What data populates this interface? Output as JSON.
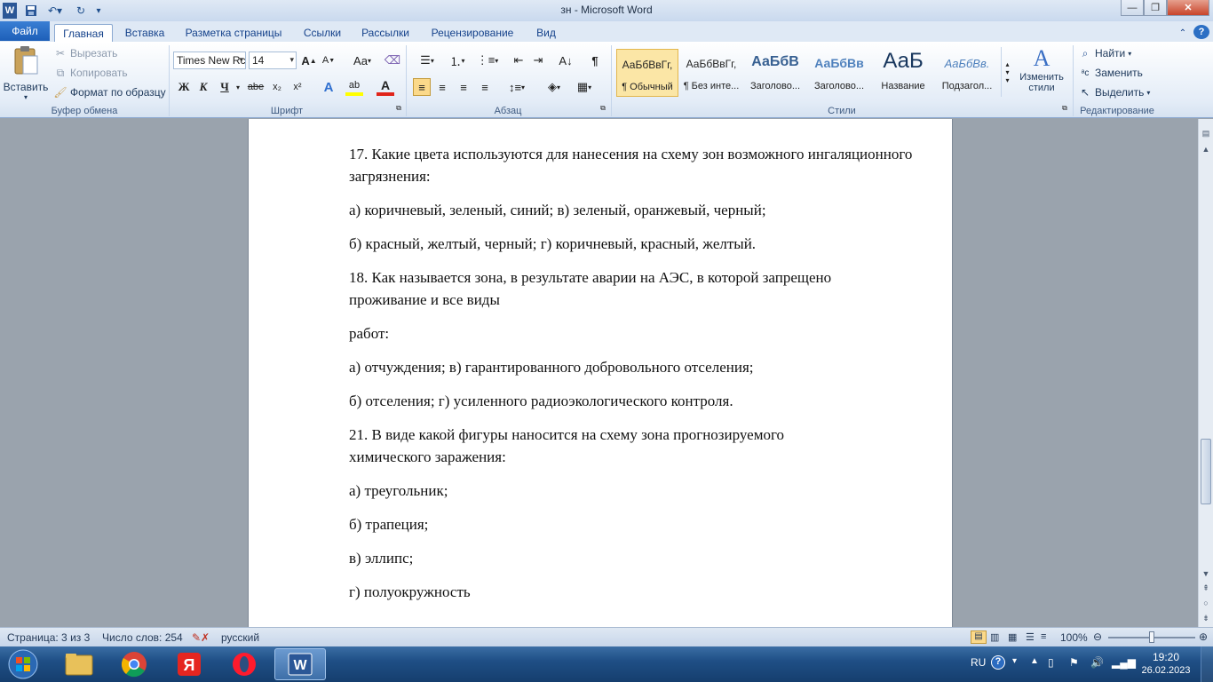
{
  "window": {
    "title": "зн  -  Microsoft Word",
    "quick_access": [
      "word-logo-icon",
      "save-icon",
      "undo-icon",
      "redo-icon",
      "customize-icon"
    ]
  },
  "tabs": [
    "Файл",
    "Главная",
    "Вставка",
    "Разметка страницы",
    "Ссылки",
    "Рассылки",
    "Рецензирование",
    "Вид"
  ],
  "ribbon": {
    "clipboard": {
      "paste": "Вставить",
      "cut": "Вырезать",
      "copy": "Копировать",
      "format_painter": "Формат по образцу",
      "label": "Буфер обмена"
    },
    "font": {
      "font_name": "Times New Rc",
      "font_size": "14",
      "label": "Шрифт",
      "bold": "Ж",
      "italic": "К",
      "underline": "Ч",
      "strike": "abe",
      "sub": "x₂",
      "sup": "x²",
      "grow": "A",
      "shrink": "A",
      "case": "Aa",
      "text_effects": "A",
      "highlight": "ab",
      "font_color": "A"
    },
    "paragraph": {
      "label": "Абзац"
    },
    "styles": {
      "label": "Стили",
      "items": [
        {
          "preview": "АаБбВвГг,",
          "name": "¶ Обычный"
        },
        {
          "preview": "АаБбВвГг,",
          "name": "¶ Без инте..."
        },
        {
          "preview": "АаБбВ",
          "name": "Заголово..."
        },
        {
          "preview": "АаБбВв",
          "name": "Заголово..."
        },
        {
          "preview": "АаБ",
          "name": "Название"
        },
        {
          "preview": "АаБбВв.",
          "name": "Подзагол..."
        }
      ],
      "change_styles": "Изменить стили"
    },
    "editing": {
      "label": "Редактирование",
      "find": "Найти",
      "replace": "Заменить",
      "select": "Выделить"
    }
  },
  "document": {
    "paragraphs": [
      "17. Какие цвета используются для нанесения на схему зон возможного ингаляционного загрязнения:",
      "а) коричневый, зеленый, синий; в) зеленый, оранжевый, черный;",
      "б) красный, желтый, черный; г) коричневый, красный, желтый.",
      "18. Как называется зона, в результате аварии на АЭС, в которой запрещено проживание и все виды",
      "работ:",
      "а) отчуждения; в) гарантированного добровольного отселения;",
      "б) отселения; г) усиленного радиоэкологического контроля.",
      "21. В виде какой фигуры наносится на схему зона прогнозируемого химического заражения:",
      "а) треугольник;",
      "б) трапеция;",
      "в) эллипс;",
      "г) полуокружность"
    ]
  },
  "status": {
    "page": "Страница: 3 из 3",
    "words": "Число слов: 254",
    "language": "русский",
    "zoom": "100%",
    "zoom_level_percent": 100
  },
  "taskbar": {
    "apps": [
      "start-orb-icon",
      "explorer-icon",
      "chrome-icon",
      "yandex-icon",
      "opera-icon",
      "word-icon"
    ],
    "lang": "RU",
    "time": "19:20",
    "date": "26.02.2023"
  },
  "colors": {
    "file_tab": "#1d5fb8",
    "ribbon": "#e3ecf7",
    "taskbar": "#1f4f86",
    "workspace": "#9aa3ad"
  }
}
